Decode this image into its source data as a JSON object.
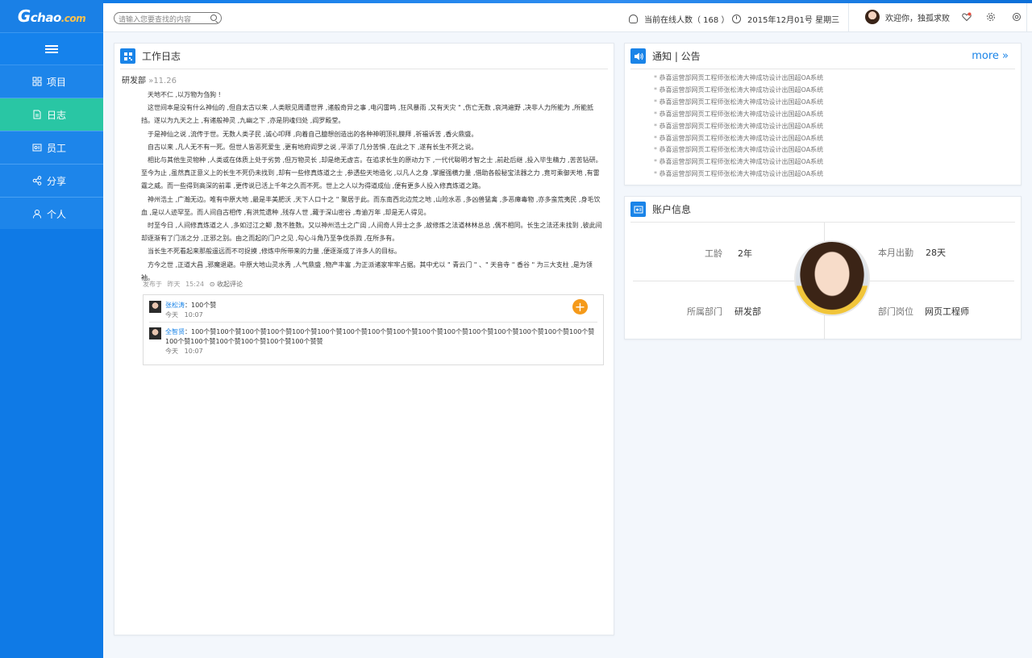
{
  "brand": {
    "logo_g": "G",
    "logo_main": "chao",
    "logo_suffix": ".com"
  },
  "sidebar": {
    "items": [
      {
        "label": "项目",
        "icon": "grid-icon",
        "active": false
      },
      {
        "label": "日志",
        "icon": "document-icon",
        "active": true
      },
      {
        "label": "员工",
        "icon": "id-card-icon",
        "active": false
      },
      {
        "label": "分享",
        "icon": "share-icon",
        "active": false
      },
      {
        "label": "个人",
        "icon": "user-icon",
        "active": false
      }
    ]
  },
  "header": {
    "search_placeholder": "请输入您要查找的内容",
    "online_label": "当前在线人数（ 168 ）",
    "date_label": "2015年12月01号  星期三",
    "welcome": "欢迎你，独孤求败"
  },
  "work_log": {
    "title": "工作日志",
    "dept": "研发部",
    "date_sep": "»",
    "date": "11.26",
    "paragraphs": [
      "天地不仁 ,以万物为刍狗 !",
      "这世间本是没有什么神仙的 ,但自太古以来 ,人类眼见周遭世界 ,诸般奇异之事 ,电闪雷鸣 ,狂风暴雨 ,又有天灾 \" ,伤亡无数 ,哀鸿遍野 ,决非人力所能为 ,所能抵挡。遂以为九天之上 ,有诸般神灵 ,九幽之下 ,亦是阴魂归处 ,阎罗殿堂。",
      "于是神仙之说 ,流传于世。无数人类子民 ,诚心叩拜 ,向着自己臆想创造出的各种神明顶礼膜拜 ,祈福诉苦 ,香火鼎盛。",
      "自古以来 ,凡人无不有一死。但世人皆恶死爱生 ,更有地府阎罗之说 ,平添了几分苦惧 ,在此之下 ,遂有长生不死之说。",
      "相比与其他生灵物种 ,人类或在体质上处于劣势 ,但万物灵长 ,却是绝无虚言。在追求长生的原动力下 ,一代代聪明才智之士 ,前赴后继 ,投入毕生精力 ,苦苦钻研。至今为止 ,虽然真正意义上的长生不死仍未找到 ,却有一些修真炼道之士 ,参透些天地造化 ,以凡人之身 ,掌握强横力量 ,借助各般秘宝法器之力 ,竟可乘御天地 ,有雷霆之威。而一些得到高深的前辈 ,更传说已活上千年之久而不死。世上之人以为得道成仙 ,便有更多人投入修真炼道之路。",
      "神州浩土 ,广瀚无边。唯有中原大地 ,最是丰美肥沃 ,天下人口十之 \" 聚居于此。而东南西北边荒之地 ,山险水恶 ,多凶兽猛禽 ,多恶瘴毒物 ,亦多蛮荒夷民 ,身毛饮血 ,是以人迹罕至。而人间自古相传 ,有洪荒遗种 ,残存人世 ,藏于深山密谷 ,寿逾万年 ,却是无人得见。",
      "时至今日 ,人间修真炼道之人 ,多如过江之鲫 ,数不胜数。又以神州浩土之广阔 ,人间奇人异士之多 ,故修炼之法道林林总总 ,偶不相同。长生之法还未找到 ,彼此间却逐渐有了门派之分 ,正邪之别。由之而起的门户之见 ,勾心斗角乃至争伐杀戮 ,在所多有。",
      "当长生不死看起来那般遥远而不可捉摸 ,修炼中所带来的力量 ,便逐渐成了许多人的目标。",
      "方今之世 ,正道大昌 ,邪魔退避。中原大地山灵水秀 ,人气鼎盛 ,物产丰富 ,为正派诸家牢牢占据。其中尤以 \" 青云门 \" 、\" 天音寺 \" 香谷 \" 为三大支柱 ,是为领袖。"
    ],
    "posted_label": "发布于",
    "posted_day": "昨天",
    "posted_time": "15:24",
    "comment_toggle": "⊙ 收起评论",
    "comments": [
      {
        "name": "张松涛",
        "text": "100个赞",
        "day": "今天",
        "time": "10:07"
      },
      {
        "name": "全智贤",
        "text": "100个赞100个赞100个赞100个赞100个赞100个赞100个赞100个赞100个赞100个赞100个赞100个赞100个赞100个赞100个赞100个赞100个赞100个赞100个赞100个赞100个赞100个赞赞",
        "day": "今天",
        "time": "10:07"
      }
    ],
    "plus_symbol": "+"
  },
  "notice": {
    "title": "通知 | 公告",
    "more": "more »",
    "items": [
      "恭喜运营部网页工程师张松涛大神成功设计出国超OA系统",
      "恭喜运营部网页工程师张松涛大神成功设计出国超OA系统",
      "恭喜运营部网页工程师张松涛大神成功设计出国超OA系统",
      "恭喜运营部网页工程师张松涛大神成功设计出国超OA系统",
      "恭喜运营部网页工程师张松涛大神成功设计出国超OA系统",
      "恭喜运营部网页工程师张松涛大神成功设计出国超OA系统",
      "恭喜运营部网页工程师张松涛大神成功设计出国超OA系统",
      "恭喜运营部网页工程师张松涛大神成功设计出国超OA系统",
      "恭喜运营部网页工程师张松涛大神成功设计出国超OA系统"
    ]
  },
  "account": {
    "title": "账户信息",
    "seniority_label": "工龄",
    "seniority_value": "2年",
    "attendance_label": "本月出勤",
    "attendance_value": "28天",
    "dept_label": "所属部门",
    "dept_value": "研发部",
    "post_label": "部门岗位",
    "post_value": "网页工程师"
  },
  "colors": {
    "primary": "#1d85ea",
    "active": "#29c6a4",
    "accent": "#f59a1a"
  }
}
